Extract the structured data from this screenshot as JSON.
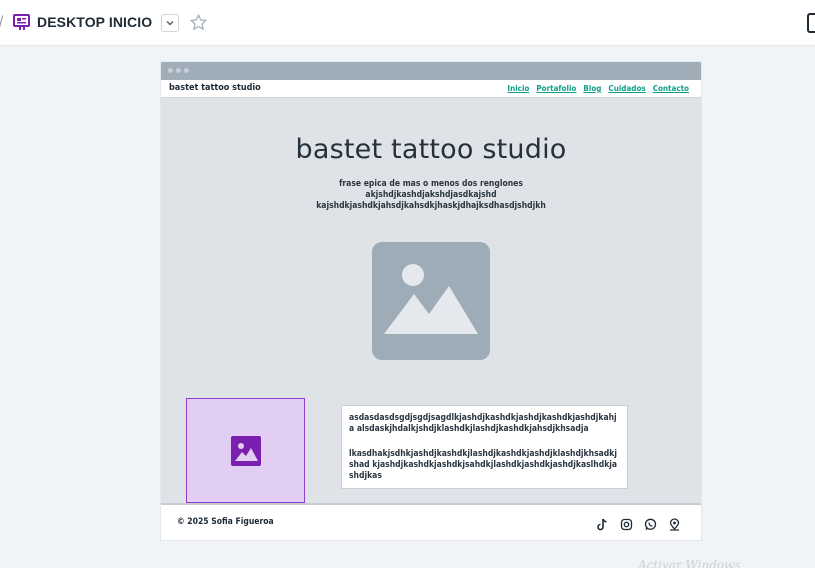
{
  "header": {
    "breadcrumb_sep": "/",
    "title": "DESKTOP INICIO",
    "icons": [
      "frame-icon",
      "chevron-down-icon",
      "star-icon",
      "panel-icon"
    ]
  },
  "site": {
    "brand": "bastet tattoo studio",
    "nav": [
      "Inicio",
      "Portafolio",
      "Blog",
      "Cuidados",
      "Contacto"
    ],
    "hero_title": "bastet tattoo studio",
    "hero_subtitle": "frase epica de mas o menos dos renglones akjshdjkashdjakshdjasdkajshd kajshdkjashdkjahsdjkahsdkjhaskjdhajksdhasdjshdjkh",
    "text_block": {
      "paragraph_1": "asdasdasdsgdjsgdjsagdlkjashdjkashdkjashdjkashdkjashdjkahja alsdaskjhdalkjshdjklashdkjlashdjkashdkjahsdjkhsadja",
      "paragraph_2": "lkasdhakjsdhkjashdjkashdkjlashdjkashdkjashdjklashdjkhsadkjshad kjashdjkashdkjashdkjsahdkjlashdkjashdkjashdjkaslhdkjashdjkas"
    },
    "footer": {
      "copyright": "© 2025 Sofia Figueroa",
      "social_icons": [
        "tiktok-icon",
        "instagram-icon",
        "whatsapp-icon",
        "location-pin-icon"
      ]
    }
  },
  "colors": {
    "accent": "#0f9f86",
    "selection": "#8d3fd2",
    "placeholder": "#9eacb8",
    "frame_icon": "#7a1fb0"
  },
  "watermark": "Activar Windows"
}
